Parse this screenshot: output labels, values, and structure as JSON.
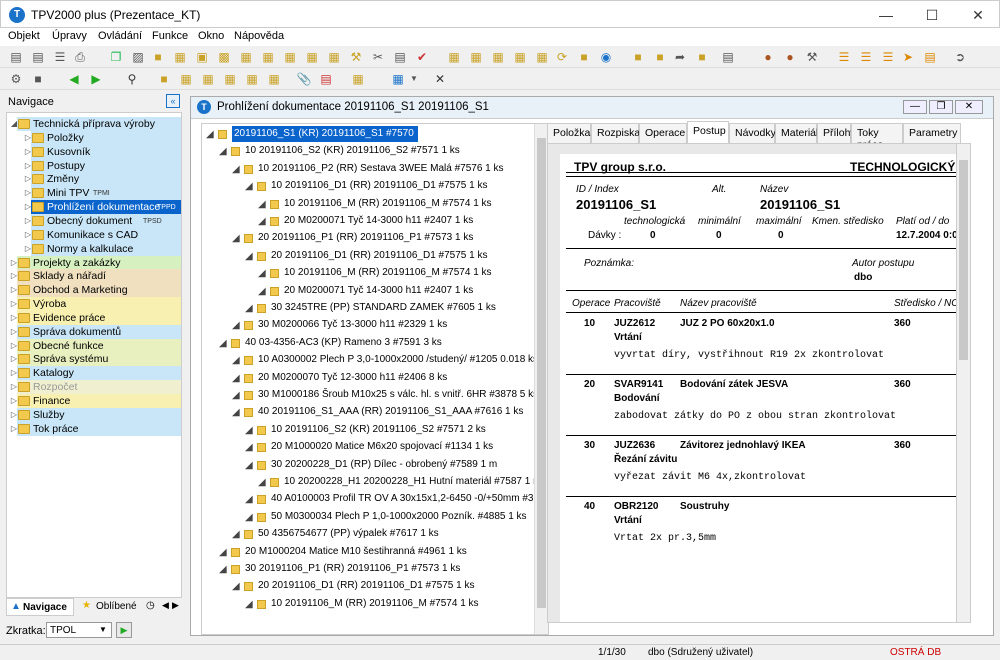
{
  "app": {
    "title": "TPV2000 plus (Prezentace_KT)",
    "icon": "T"
  },
  "menu": [
    "Objekt",
    "Úpravy",
    "Ovládání",
    "Funkce",
    "Okno",
    "Nápověda"
  ],
  "nav": {
    "header": "Navigace",
    "items": [
      {
        "label": "Technická příprava výroby",
        "color": "#c8e6f7"
      },
      {
        "label": "Položky",
        "color": "#c8e6f7"
      },
      {
        "label": "Kusovník",
        "color": "#c8e6f7"
      },
      {
        "label": "Postupy",
        "color": "#c8e6f7"
      },
      {
        "label": "Změny",
        "color": "#c8e6f7"
      },
      {
        "label": "Mini TPV",
        "sub": "TPMI",
        "color": "#c8e6f7"
      },
      {
        "label": "Prohlížení dokumentace",
        "sub": "TPPD",
        "color": "#0a64cc"
      },
      {
        "label": "Obecný dokument",
        "sub": "TPSD",
        "color": "#c8e6f7"
      },
      {
        "label": "Komunikace s CAD",
        "color": "#c8e6f7"
      },
      {
        "label": "Normy a kalkulace",
        "color": "#c8e6f7"
      },
      {
        "label": "Projekty a zakázky",
        "color": "#d6f0c0"
      },
      {
        "label": "Sklady a nářadí",
        "color": "#f0e0c0"
      },
      {
        "label": "Obchod a Marketing",
        "color": "#f0e0c0"
      },
      {
        "label": "Výroba",
        "color": "#f8f0b0"
      },
      {
        "label": "Evidence práce",
        "color": "#f8f0b0"
      },
      {
        "label": "Správa dokumentů",
        "color": "#c8e6f7"
      },
      {
        "label": "Obecné funkce",
        "color": "#e8f0c0"
      },
      {
        "label": "Správa systému",
        "color": "#e8f0c0"
      },
      {
        "label": "Katalogy",
        "color": "#c8e6f7"
      },
      {
        "label": "Rozpočet",
        "color": "#f0f0d0"
      },
      {
        "label": "Finance",
        "color": "#f8f0b0"
      },
      {
        "label": "Služby",
        "color": "#c8e6f7"
      },
      {
        "label": "Tok práce",
        "color": "#c8e6f7"
      }
    ],
    "tab_nav": "Navigace",
    "tab_fav": "Oblíbené",
    "zkratka_label": "Zkratka:",
    "zkratka_value": "TPOL"
  },
  "doc": {
    "title": "Prohlížení dokumentace 20191106_S1 20191106_S1",
    "tree": [
      {
        "lvl": 0,
        "text": "20191106_S1 (KR) 20191106_S1 #7570",
        "sel": true
      },
      {
        "lvl": 1,
        "text": "10 20191106_S2 (KR) 20191106_S2 #7571 1 ks"
      },
      {
        "lvl": 2,
        "text": "10 20191106_P2 (RR) Sestava 3WEE Malá #7576 1 ks"
      },
      {
        "lvl": 3,
        "text": "10 20191106_D1 (RR) 20191106_D1 #7575 1 ks"
      },
      {
        "lvl": 4,
        "text": "10 20191106_M (RR) 20191106_M #7574 1 ks"
      },
      {
        "lvl": 4,
        "text": "20 M0200071 Tyč 14-3000 h11 #2407 1 ks"
      },
      {
        "lvl": 2,
        "text": "20 20191106_P1 (RR) 20191106_P1 #7573 1 ks"
      },
      {
        "lvl": 3,
        "text": "20 20191106_D1 (RR) 20191106_D1 #7575 1 ks"
      },
      {
        "lvl": 4,
        "text": "10 20191106_M (RR) 20191106_M #7574 1 ks"
      },
      {
        "lvl": 4,
        "text": "20 M0200071 Tyč 14-3000 h11 #2407 1 ks"
      },
      {
        "lvl": 3,
        "text": "30 3245TRE (PP) STANDARD ZAMEK #7605 1 ks"
      },
      {
        "lvl": 2,
        "text": "30 M0200066 Tyč 13-3000 h11 #2329 1 ks"
      },
      {
        "lvl": 1,
        "text": "40 03-4356-AC3 (KP) Rameno 3 #7591 3 ks"
      },
      {
        "lvl": 2,
        "text": "10 A0300002 Plech P 3,0-1000x2000 /studený/ #1205 0.018 ks"
      },
      {
        "lvl": 2,
        "text": "20 M0200070 Tyč 12-3000 h11 #2406 8 ks"
      },
      {
        "lvl": 2,
        "text": "30 M1000186 Šroub M10x25 s válc. hl. s vnitř. 6HR #3878 5 ks"
      },
      {
        "lvl": 2,
        "text": "40 20191106_S1_AAA (RR) 20191106_S1_AAA #7616 1 ks"
      },
      {
        "lvl": 3,
        "text": "10 20191106_S2 (KR) 20191106_S2 #7571 2 ks"
      },
      {
        "lvl": 3,
        "text": "20 M1000020 Matice M6x20 spojovací #1134 1 ks"
      },
      {
        "lvl": 3,
        "text": "30 20200228_D1 (RP) Dílec - obrobený #7589 1 m"
      },
      {
        "lvl": 4,
        "text": "10 20200228_H1 20200228_H1 Hutní materiál #7587 1 m"
      },
      {
        "lvl": 3,
        "text": "40 A0100003 Profil TR OV A 30x15x1,2-6450 -0/+50mm #3752"
      },
      {
        "lvl": 3,
        "text": "50 M0300034 Plech P 1,0-1000x2000 Pozník. #4885 1 ks"
      },
      {
        "lvl": 2,
        "text": "50 4356754677 (PP) výpalek #7617 1 ks"
      },
      {
        "lvl": 1,
        "text": "20 M1000204 Matice M10 šestihranná #4961 1 ks"
      },
      {
        "lvl": 1,
        "text": "30 20191106_P1 (RR) 20191106_P1 #7573 1 ks"
      },
      {
        "lvl": 2,
        "text": "20 20191106_D1 (RR) 20191106_D1 #7575 1 ks"
      },
      {
        "lvl": 3,
        "text": "10 20191106_M (RR) 20191106_M #7574 1 ks"
      }
    ],
    "tabs": [
      "Položka",
      "Rozpiska",
      "Operace",
      "Postup",
      "Návodky",
      "Materiál",
      "Přílohy",
      "Toky práce",
      "Parametry"
    ],
    "active_tab": "Postup",
    "paper": {
      "company": "TPV group s.r.o.",
      "doc_type": "TECHNOLOGICKÝ PO",
      "id_label": "ID / Index",
      "alt_label": "Alt.",
      "name_label": "Název",
      "id_value": "20191106_S1",
      "name_value": "20191106_S1",
      "h_tech": "technologická",
      "h_min": "minimální",
      "h_max": "maximální",
      "h_kmen": "Kmen. středisko",
      "h_plati": "Platí od / do",
      "davky_label": "Dávky :",
      "d_tech": "0",
      "d_min": "0",
      "d_max": "0",
      "plati": "12.7.2004 0:0",
      "poznamka_label": "Poznámka:",
      "autor_label": "Autor postupu",
      "autor_value": "dbo",
      "col_op": "Operace",
      "col_prac": "Pracoviště",
      "col_nazev": "Název pracoviště",
      "col_stred": "Středisko / NC",
      "ops": [
        {
          "op": "10",
          "prac": "JUZ2612",
          "nazev": "JUZ 2 PO 60x20x1.0",
          "stred": "360",
          "type": "Vrtání",
          "desc": "vyvrtat díry, vystřihnout R19 2x zkontrolovat"
        },
        {
          "op": "20",
          "prac": "SVAR9141",
          "nazev": "Bodování zátek JESVA",
          "stred": "360",
          "type": "Bodování",
          "desc": "zabodovat zátky do PO z obou stran zkontrolovat"
        },
        {
          "op": "30",
          "prac": "JUZ2636",
          "nazev": "Závitorez jednohlavý IKEA",
          "stred": "360",
          "type": "Řezání závitu",
          "desc": "vyřezat závit M6 4x,zkontrolovat"
        },
        {
          "op": "40",
          "prac": "OBR2120",
          "nazev": "Soustruhy",
          "stred": "",
          "type": "Vrtání",
          "desc": "Vrtat 2x pr.3,5mm"
        }
      ]
    }
  },
  "status": {
    "pages": "1/1/30",
    "user": "dbo (Sdružený uživatel)",
    "db": "OSTRÁ DB"
  }
}
